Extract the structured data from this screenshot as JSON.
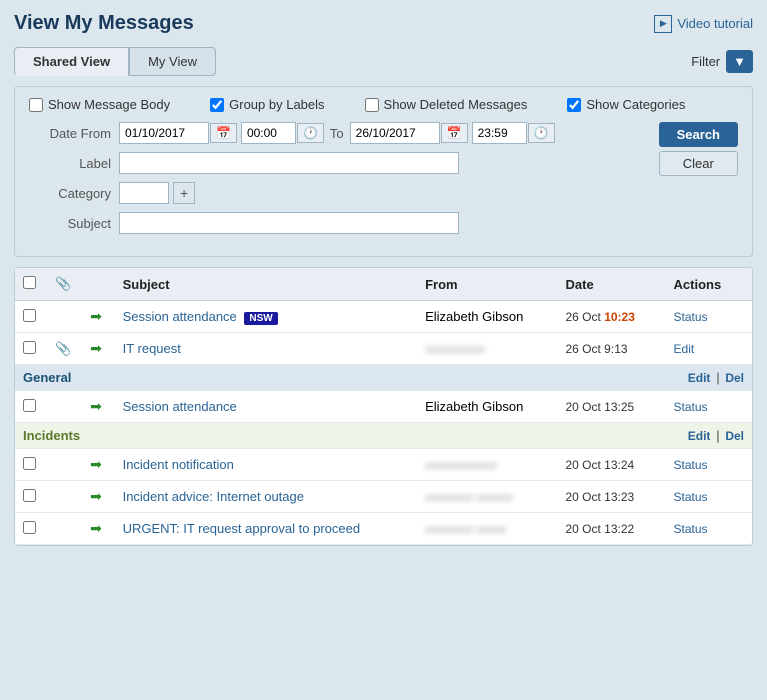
{
  "page": {
    "title": "View My Messages",
    "video_tutorial_label": "Video tutorial"
  },
  "tabs": {
    "shared_view_label": "Shared View",
    "my_view_label": "My View",
    "active": "shared_view"
  },
  "filter": {
    "label": "Filter"
  },
  "options": {
    "show_message_body_label": "Show Message Body",
    "show_message_body_checked": false,
    "group_by_labels_label": "Group by Labels",
    "group_by_labels_checked": true,
    "show_deleted_messages_label": "Show Deleted Messages",
    "show_deleted_messages_checked": false,
    "show_categories_label": "Show Categories",
    "show_categories_checked": true
  },
  "search_form": {
    "date_from_label": "Date From",
    "date_from_value": "01/10/2017",
    "time_from_value": "00:00",
    "to_label": "To",
    "date_to_value": "26/10/2017",
    "time_to_value": "23:59",
    "label_label": "Label",
    "label_value": "",
    "category_label": "Category",
    "category_value": "",
    "subject_label": "Subject",
    "subject_value": "",
    "search_btn": "Search",
    "clear_btn": "Clear"
  },
  "table": {
    "col_subject": "Subject",
    "col_from": "From",
    "col_date": "Date",
    "col_actions": "Actions"
  },
  "messages": [
    {
      "id": 1,
      "checked": false,
      "has_attachment": false,
      "arrow": true,
      "subject": "Session attendance",
      "label_badge": "NSW",
      "from": "Elizabeth Gibson",
      "date": "26 Oct",
      "time": "10:23",
      "time_highlight": true,
      "action": "Status",
      "action2": null,
      "group": null
    },
    {
      "id": 2,
      "checked": false,
      "has_attachment": true,
      "arrow": true,
      "subject": "IT request",
      "label_badge": null,
      "from": "blurred",
      "date": "26 Oct",
      "time": "9:13",
      "time_highlight": false,
      "action": "Edit",
      "action2": null,
      "group": null
    },
    {
      "id": "general-group",
      "is_group": true,
      "group_label": "General",
      "group_type": "general",
      "group_actions": "Edit | Del"
    },
    {
      "id": 3,
      "checked": false,
      "has_attachment": false,
      "arrow": true,
      "subject": "Session attendance",
      "label_badge": null,
      "from": "Elizabeth Gibson",
      "date": "20 Oct",
      "time": "13:25",
      "time_highlight": false,
      "action": "Status",
      "action2": null,
      "group": "general"
    },
    {
      "id": "incidents-group",
      "is_group": true,
      "group_label": "Incidents",
      "group_type": "incidents",
      "group_actions": "Edit | Del"
    },
    {
      "id": 4,
      "checked": false,
      "has_attachment": false,
      "arrow": true,
      "subject": "Incident notification",
      "label_badge": null,
      "from": "blurred",
      "date": "20 Oct",
      "time": "13:24",
      "time_highlight": false,
      "action": "Status",
      "action2": null,
      "group": "incidents"
    },
    {
      "id": 5,
      "checked": false,
      "has_attachment": false,
      "arrow": true,
      "subject": "Incident advice: Internet outage",
      "label_badge": null,
      "from": "blurred2",
      "date": "20 Oct",
      "time": "13:23",
      "time_highlight": false,
      "action": "Status",
      "action2": null,
      "group": "incidents"
    },
    {
      "id": 6,
      "checked": false,
      "has_attachment": false,
      "arrow": true,
      "subject": "URGENT: IT request approval to proceed",
      "label_badge": null,
      "from": "blurred3",
      "date": "20 Oct",
      "time": "13:22",
      "time_highlight": false,
      "action": "Status",
      "action2": null,
      "group": "incidents"
    }
  ]
}
